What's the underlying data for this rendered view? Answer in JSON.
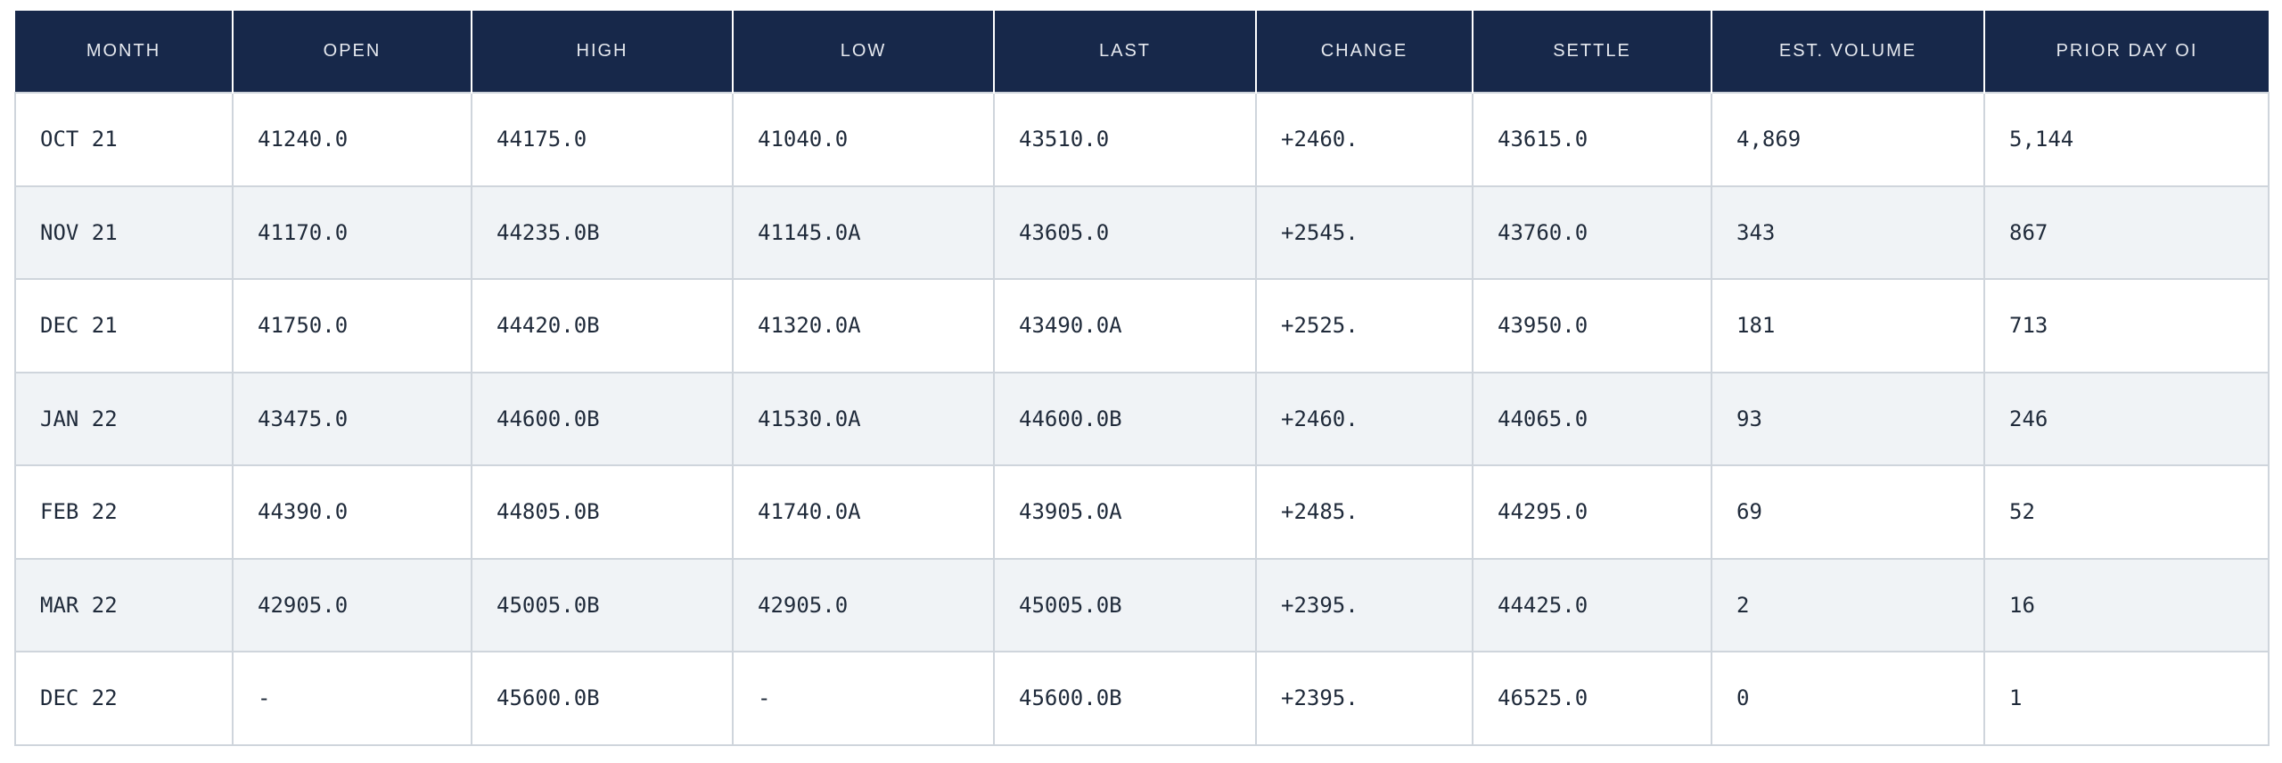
{
  "table": {
    "headers": [
      "MONTH",
      "OPEN",
      "HIGH",
      "LOW",
      "LAST",
      "CHANGE",
      "SETTLE",
      "EST. VOLUME",
      "PRIOR DAY OI"
    ],
    "rows": [
      [
        "OCT 21",
        "41240.0",
        "44175.0",
        "41040.0",
        "43510.0",
        "+2460.",
        "43615.0",
        "4,869",
        "5,144"
      ],
      [
        "NOV 21",
        "41170.0",
        "44235.0B",
        "41145.0A",
        "43605.0",
        "+2545.",
        "43760.0",
        "343",
        "867"
      ],
      [
        "DEC 21",
        "41750.0",
        "44420.0B",
        "41320.0A",
        "43490.0A",
        "+2525.",
        "43950.0",
        "181",
        "713"
      ],
      [
        "JAN 22",
        "43475.0",
        "44600.0B",
        "41530.0A",
        "44600.0B",
        "+2460.",
        "44065.0",
        "93",
        "246"
      ],
      [
        "FEB 22",
        "44390.0",
        "44805.0B",
        "41740.0A",
        "43905.0A",
        "+2485.",
        "44295.0",
        "69",
        "52"
      ],
      [
        "MAR 22",
        "42905.0",
        "45005.0B",
        "42905.0",
        "45005.0B",
        "+2395.",
        "44425.0",
        "2",
        "16"
      ],
      [
        "DEC 22",
        "-",
        "45600.0B",
        "-",
        "45600.0B",
        "+2395.",
        "46525.0",
        "0",
        "1"
      ]
    ]
  },
  "colors": {
    "header_bg": "#17284a",
    "header_text": "#e6e9ef",
    "row_alt_bg": "#f0f3f6",
    "border": "#cfd5dc"
  }
}
